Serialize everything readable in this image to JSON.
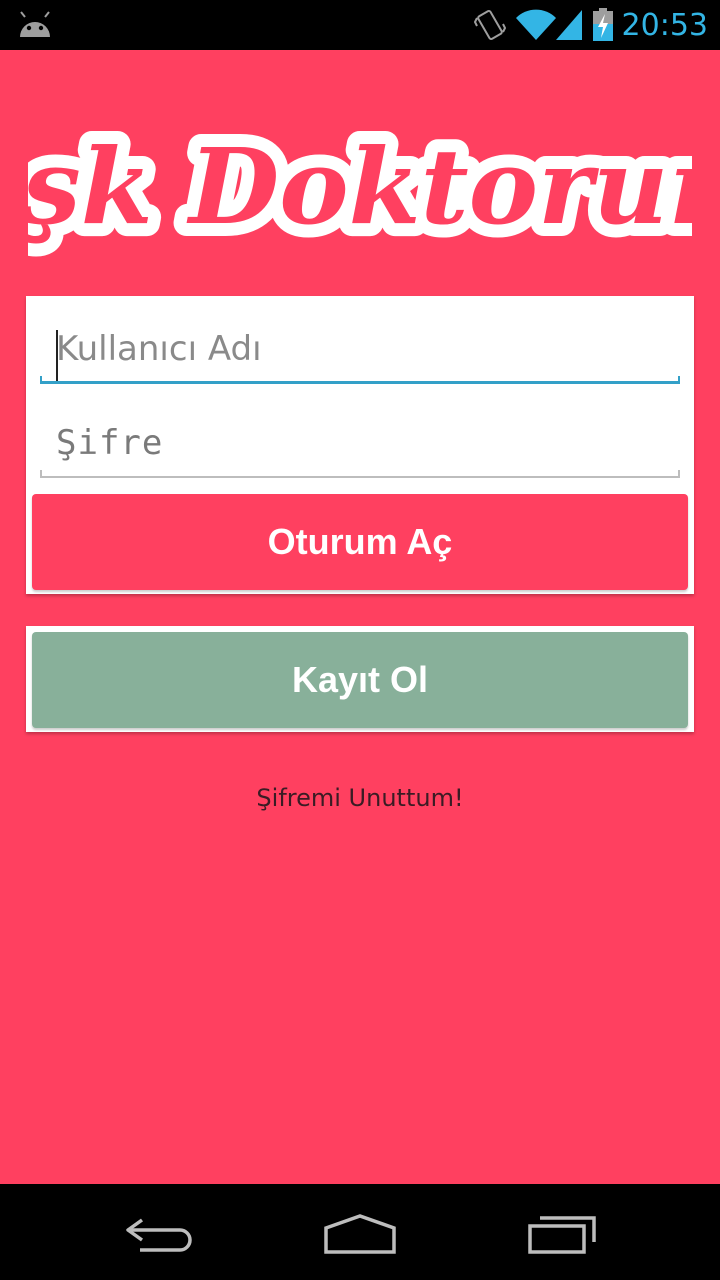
{
  "status_bar": {
    "time": "20:53",
    "icons": [
      "android-icon",
      "vibrate-icon",
      "wifi-icon",
      "signal-icon",
      "battery-charging-icon"
    ]
  },
  "app": {
    "logo_text": "Aşk Doktorum",
    "background_color": "#ff4060",
    "username": {
      "placeholder": "Kullanıcı Adı",
      "value": ""
    },
    "password": {
      "placeholder": "Şifre",
      "value": ""
    },
    "login_button_label": "Oturum Aç",
    "login_button_color": "#ff4060",
    "register_button_label": "Kayıt Ol",
    "register_button_color": "#88b09a",
    "forgot_password_label": "Şifremi Unuttum!"
  },
  "nav_bar": {
    "icons": [
      "back-icon",
      "home-icon",
      "recents-icon"
    ]
  }
}
